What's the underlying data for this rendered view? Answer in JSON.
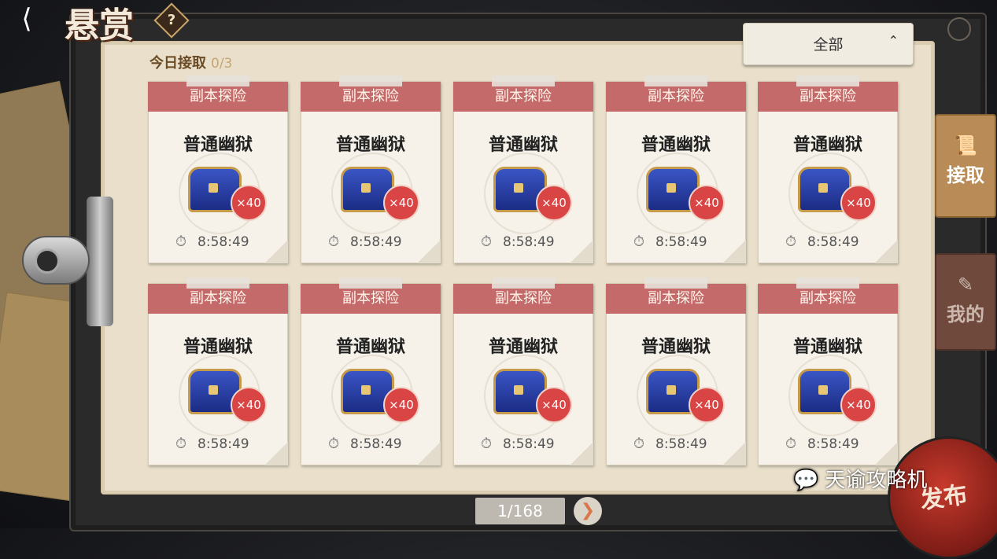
{
  "header": {
    "back_icon": "back-arrow-icon",
    "title": "悬赏",
    "help": "?"
  },
  "today": {
    "label": "今日接取",
    "count": "0/3"
  },
  "filter": {
    "value": "全部",
    "chevron": "⌃"
  },
  "side_tabs": [
    {
      "label": "接取",
      "icon": "scroll-icon",
      "active": true
    },
    {
      "label": "我的",
      "icon": "pencil-icon",
      "active": false
    }
  ],
  "cards": [
    {
      "banner": "副本探险",
      "name": "普通幽狱",
      "reward": "×40",
      "timer": "8:58:49"
    },
    {
      "banner": "副本探险",
      "name": "普通幽狱",
      "reward": "×40",
      "timer": "8:58:49"
    },
    {
      "banner": "副本探险",
      "name": "普通幽狱",
      "reward": "×40",
      "timer": "8:58:49"
    },
    {
      "banner": "副本探险",
      "name": "普通幽狱",
      "reward": "×40",
      "timer": "8:58:49"
    },
    {
      "banner": "副本探险",
      "name": "普通幽狱",
      "reward": "×40",
      "timer": "8:58:49"
    },
    {
      "banner": "副本探险",
      "name": "普通幽狱",
      "reward": "×40",
      "timer": "8:58:49"
    },
    {
      "banner": "副本探险",
      "name": "普通幽狱",
      "reward": "×40",
      "timer": "8:58:49"
    },
    {
      "banner": "副本探险",
      "name": "普通幽狱",
      "reward": "×40",
      "timer": "8:58:49"
    },
    {
      "banner": "副本探险",
      "name": "普通幽狱",
      "reward": "×40",
      "timer": "8:58:49"
    },
    {
      "banner": "副本探险",
      "name": "普通幽狱",
      "reward": "×40",
      "timer": "8:58:49"
    }
  ],
  "pagination": {
    "page": "1/168"
  },
  "publish": {
    "label": "发布"
  },
  "watermark": {
    "text": "天谕攻略机"
  },
  "colors": {
    "banner": "#c46a6a",
    "badge": "#d94545",
    "paper": "#e9dfca",
    "active_tab": "#b98b57"
  }
}
